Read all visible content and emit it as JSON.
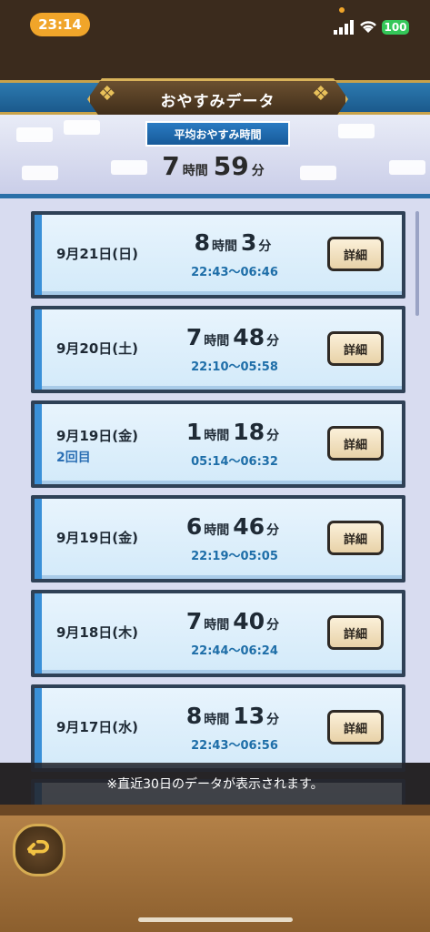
{
  "status": {
    "time": "23:14",
    "battery": "100"
  },
  "header": {
    "title": "おやすみデータ"
  },
  "summary": {
    "banner": "平均おやすみ時間",
    "hours": "7",
    "hours_unit": "時間",
    "minutes": "59",
    "minutes_unit": "分"
  },
  "records": [
    {
      "date": "9月21日(日)",
      "hours": "8",
      "minutes": "3",
      "range": "22:43～06:46",
      "note": "",
      "button": "詳細"
    },
    {
      "date": "9月20日(土)",
      "hours": "7",
      "minutes": "48",
      "range": "22:10～05:58",
      "note": "",
      "button": "詳細"
    },
    {
      "date": "9月19日(金)",
      "hours": "1",
      "minutes": "18",
      "range": "05:14～06:32",
      "note": "2回目",
      "button": "詳細"
    },
    {
      "date": "9月19日(金)",
      "hours": "6",
      "minutes": "46",
      "range": "22:19～05:05",
      "note": "",
      "button": "詳細"
    },
    {
      "date": "9月18日(木)",
      "hours": "7",
      "minutes": "40",
      "range": "22:44～06:24",
      "note": "",
      "button": "詳細"
    },
    {
      "date": "9月17日(水)",
      "hours": "8",
      "minutes": "13",
      "range": "22:43～06:56",
      "note": "",
      "button": "詳細"
    }
  ],
  "units": {
    "hours": "時間",
    "minutes": "分"
  },
  "notice": "※直近30日のデータが表示されます。",
  "icons": {
    "back": "back-arrow-icon",
    "signal": "signal-icon",
    "wifi": "wifi-icon",
    "battery": "battery-icon"
  },
  "colors": {
    "accent": "#2a7bc2",
    "status_pill": "#f0a52a"
  }
}
